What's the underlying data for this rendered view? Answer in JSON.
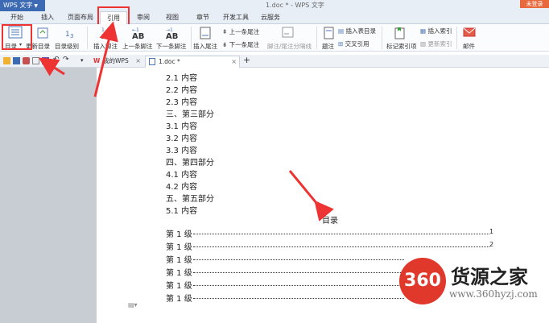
{
  "titlebar": {
    "app_menu": "WPS 文字",
    "doc_title": "1.doc * - WPS 文字",
    "login": "未登录"
  },
  "tabs": [
    {
      "label": "开始"
    },
    {
      "label": "插入"
    },
    {
      "label": "页面布局"
    },
    {
      "label": "引用"
    },
    {
      "label": "审阅"
    },
    {
      "label": "视图"
    },
    {
      "label": "章节"
    },
    {
      "label": "开发工具"
    },
    {
      "label": "云服务"
    }
  ],
  "ribbon": {
    "toc": "目录",
    "update_toc": "更新目录",
    "toc_level": "目录级别",
    "insert_footnote": "插入脚注",
    "prev_footnote": "上一条脚注",
    "next_footnote": "下一条脚注",
    "insert_endnote": "插入尾注",
    "prev_endnote": "上一条尾注",
    "next_endnote": "下一条尾注",
    "footnote_sep": "脚注/尾注分隔线",
    "caption": "题注",
    "insert_table_toc": "插入表目录",
    "cross_ref": "交叉引用",
    "mark_index": "标记索引项",
    "insert_index": "插入索引",
    "update_index": "更新索引",
    "mail": "邮件"
  },
  "doc_tabs": {
    "my_wps": "我的WPS",
    "doc": "1.doc *",
    "add": "+"
  },
  "document": {
    "lines": [
      "2.1 内容",
      "2.2 内容",
      "2.3 内容",
      "三、第三部分",
      "3.1 内容",
      "3.2 内容",
      "3.3 内容",
      "四、第四部分",
      "4.1 内容",
      "4.2 内容",
      "五、第五部分",
      "5.1 内容"
    ],
    "toc_title": "目录",
    "toc_rows": [
      {
        "label": "第 1 级",
        "page": "1"
      },
      {
        "label": "第 1 级",
        "page": "2"
      },
      {
        "label": "第 1 级",
        "page": ""
      },
      {
        "label": "第 1 级",
        "page": ""
      },
      {
        "label": "第 1 级",
        "page": ""
      },
      {
        "label": "第 1 级",
        "page": ""
      }
    ]
  },
  "watermark": {
    "logo": "360",
    "name": "货源之家",
    "url": "www.360hyzj.com"
  },
  "colors": {
    "accent": "#3d6bb3",
    "highlight": "#e33333",
    "login": "#e86a3c",
    "watermark": "#e0392b"
  }
}
